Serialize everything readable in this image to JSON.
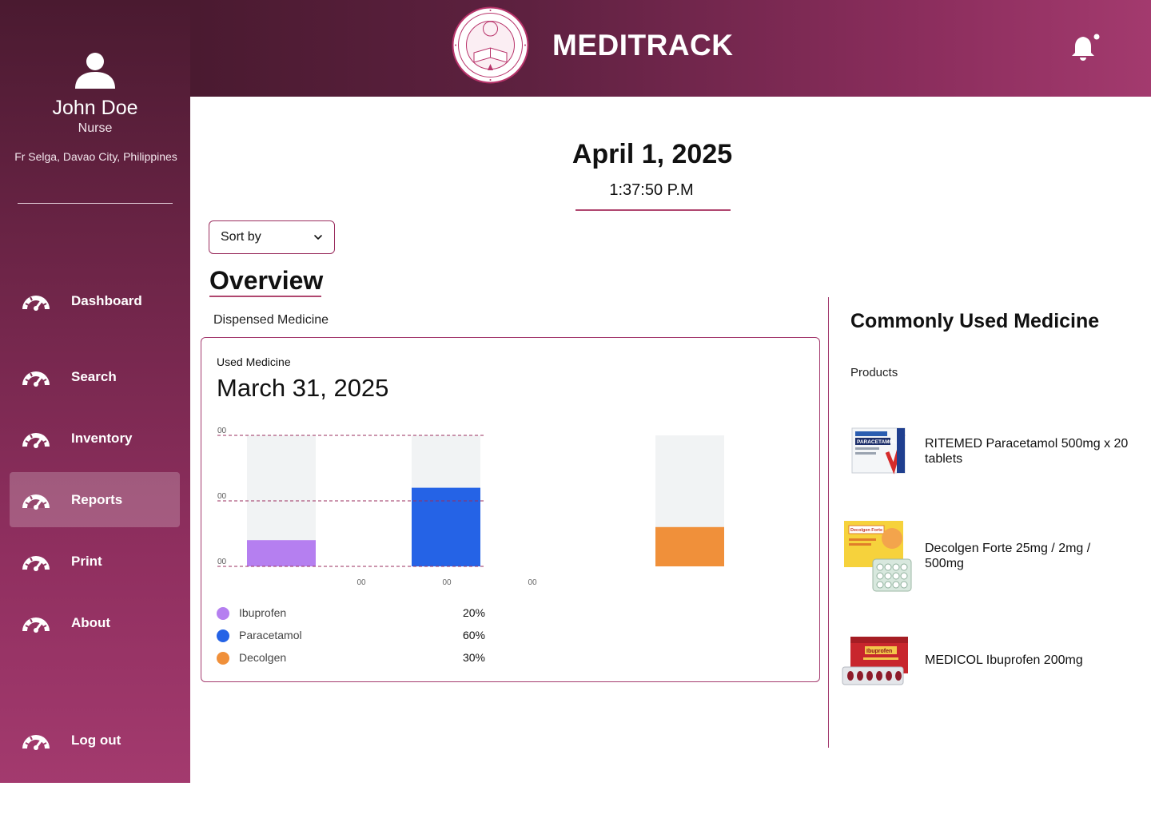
{
  "header": {
    "app_title": "MEDITRACK",
    "seal_text": "UNIVERSITY OF THE IMMACULATE CONCEPTION · DAVAO · 1905"
  },
  "user": {
    "name": "John Doe",
    "role": "Nurse",
    "location": "Fr Selga, Davao City, Philippines"
  },
  "nav": {
    "items": [
      {
        "label": "Dashboard",
        "active": false
      },
      {
        "label": "Search",
        "active": false
      },
      {
        "label": "Inventory",
        "active": false
      },
      {
        "label": "Reports",
        "active": true
      },
      {
        "label": "Print",
        "active": false
      },
      {
        "label": "About",
        "active": false
      }
    ],
    "logout_label": "Log out"
  },
  "datetime": {
    "date": "April 1, 2025",
    "time": "1:37:50 P.M"
  },
  "sort": {
    "label": "Sort by"
  },
  "overview": {
    "title": "Overview",
    "subtitle": "Dispensed Medicine",
    "card_kicker": "Used Medicine",
    "card_date": "March 31, 2025"
  },
  "chart_data": {
    "type": "bar",
    "ylim": [
      0,
      100
    ],
    "y_tick_labels": [
      "00",
      "00",
      "00"
    ],
    "x_tick_labels": [
      "00",
      "00",
      "00"
    ],
    "grid": true,
    "series": [
      {
        "name": "Ibuprofen",
        "value": 20,
        "label": "20%",
        "color": "#b57ff0"
      },
      {
        "name": "Paracetamol",
        "value": 60,
        "label": "60%",
        "color": "#2563e6"
      },
      {
        "name": "Decolgen",
        "value": 30,
        "label": "30%",
        "color": "#f0903a"
      }
    ],
    "track_color": "#f1f3f4"
  },
  "right_panel": {
    "title": "Commonly Used Medicine",
    "products_label": "Products",
    "products": [
      {
        "name": "RITEMED Paracetamol 500mg x 20 tablets",
        "package_text": "PARACETAMOL"
      },
      {
        "name": "Decolgen Forte 25mg / 2mg / 500mg",
        "package_text": "Decolgen Forte"
      },
      {
        "name": "MEDICOL Ibuprofen 200mg",
        "package_text": "Ibuprofen"
      }
    ]
  },
  "colors": {
    "accent": "#a33a6e",
    "sidebar_dark": "#4a1a30",
    "sidebar_light": "#a33a6e"
  }
}
